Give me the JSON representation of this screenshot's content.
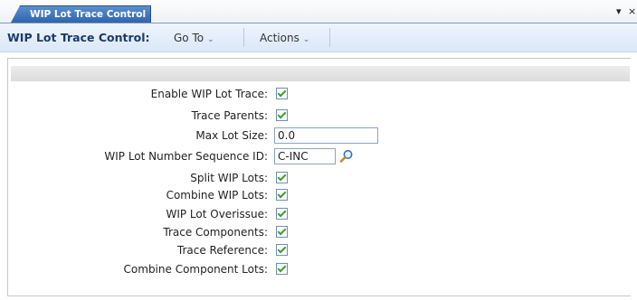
{
  "tab": {
    "label": "WIP Lot Trace Control"
  },
  "window": {
    "dropdown_glyph": "▾",
    "close_glyph": "×"
  },
  "menubar": {
    "title": "WIP Lot Trace Control:",
    "goto": "Go To",
    "actions": "Actions",
    "chevron": "⌄"
  },
  "fields": [
    {
      "label": "Enable WIP Lot Trace:",
      "type": "checkbox",
      "checked": true
    },
    {
      "label": "Trace Parents:",
      "type": "checkbox",
      "checked": true
    },
    {
      "label": "Max Lot Size:",
      "type": "text",
      "value": "0.0"
    },
    {
      "label": "WIP Lot Number Sequence ID:",
      "type": "lookup",
      "value": "C-INC"
    },
    {
      "label": "Split WIP Lots:",
      "type": "checkbox",
      "checked": true
    },
    {
      "label": "Combine WIP Lots:",
      "type": "checkbox",
      "checked": true
    },
    {
      "label": "WIP Lot Overissue:",
      "type": "checkbox",
      "checked": true
    },
    {
      "label": "Trace Components:",
      "type": "checkbox",
      "checked": true
    },
    {
      "label": "Trace Reference:",
      "type": "checkbox",
      "checked": true
    },
    {
      "label": "Combine Component Lots:",
      "type": "checkbox",
      "checked": true
    }
  ],
  "colors": {
    "accent": "#2f63ad",
    "menubar": "#dbe8f8",
    "check": "#3c9e32"
  },
  "icons": {
    "lookup": "search-icon"
  }
}
